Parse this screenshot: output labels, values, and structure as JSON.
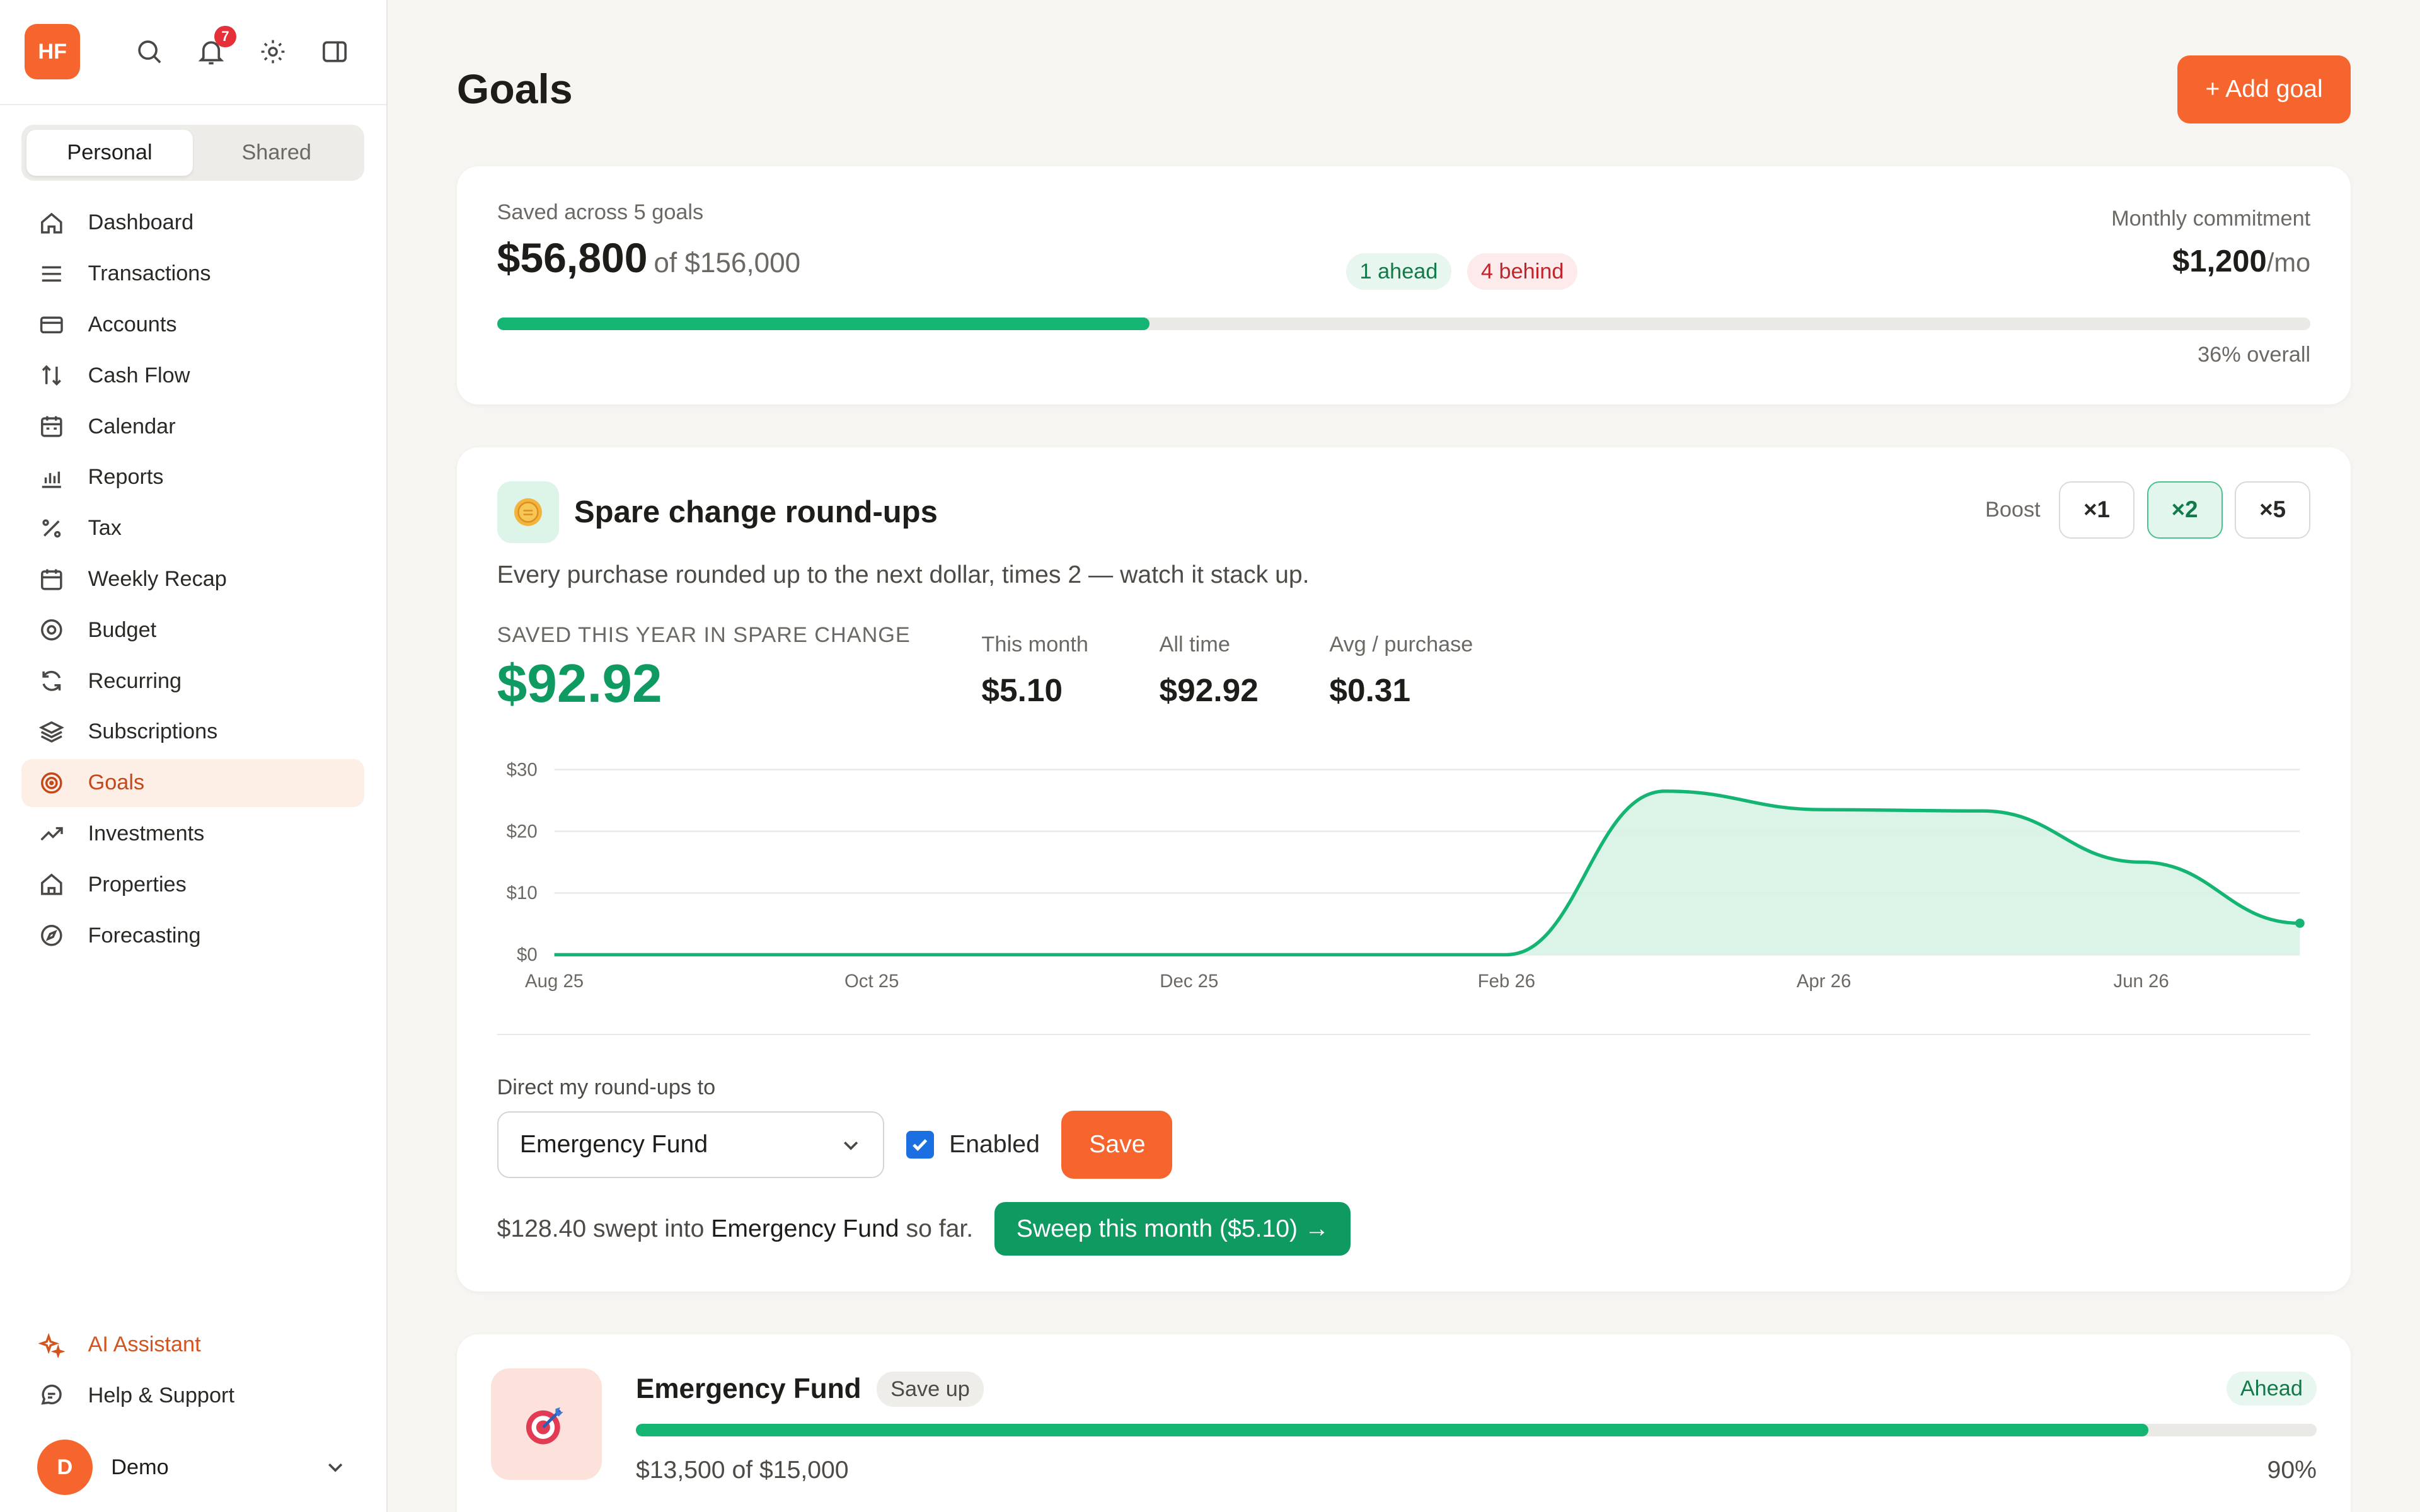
{
  "sidebar": {
    "logo": "HF",
    "notif_count": "7",
    "tabs": [
      {
        "label": "Personal",
        "active": true
      },
      {
        "label": "Shared",
        "active": false
      }
    ],
    "items": [
      {
        "label": "Dashboard",
        "icon": "home-icon"
      },
      {
        "label": "Transactions",
        "icon": "list-icon"
      },
      {
        "label": "Accounts",
        "icon": "card-icon"
      },
      {
        "label": "Cash Flow",
        "icon": "arrows-updown-icon"
      },
      {
        "label": "Calendar",
        "icon": "calendar-icon"
      },
      {
        "label": "Reports",
        "icon": "bar-chart-icon"
      },
      {
        "label": "Tax",
        "icon": "percent-icon"
      },
      {
        "label": "Weekly Recap",
        "icon": "calendar-week-icon"
      },
      {
        "label": "Budget",
        "icon": "target-icon"
      },
      {
        "label": "Recurring",
        "icon": "refresh-icon"
      },
      {
        "label": "Subscriptions",
        "icon": "layers-icon"
      },
      {
        "label": "Goals",
        "icon": "goal-icon",
        "active": true
      },
      {
        "label": "Investments",
        "icon": "trend-up-icon"
      },
      {
        "label": "Properties",
        "icon": "house-icon"
      },
      {
        "label": "Forecasting",
        "icon": "compass-icon"
      }
    ],
    "ai_label": "AI Assistant",
    "help_label": "Help & Support",
    "user": {
      "initial": "D",
      "name": "Demo"
    }
  },
  "page": {
    "title": "Goals",
    "add_label": "+ Add goal"
  },
  "summary": {
    "label": "Saved across 5 goals",
    "saved": "$56,800",
    "of_total": "of $156,000",
    "ahead": "1 ahead",
    "behind": "4 behind",
    "commit_label": "Monthly commitment",
    "commit_amount": "$1,200",
    "commit_unit": "/mo",
    "progress": 0.36,
    "overall": "36% overall"
  },
  "spare": {
    "title": "Spare change round-ups",
    "boost_label": "Boost",
    "boost_options": [
      "×1",
      "×2",
      "×5"
    ],
    "boost_active": 1,
    "description": "Every purchase rounded up to the next dollar, times 2 — watch it stack up.",
    "big_label": "SAVED THIS YEAR IN SPARE CHANGE",
    "big_value": "$92.92",
    "stats": [
      {
        "label": "This month",
        "value": "$5.10"
      },
      {
        "label": "All time",
        "value": "$92.92"
      },
      {
        "label": "Avg / purchase",
        "value": "$0.31"
      }
    ],
    "direct_label": "Direct my round-ups to",
    "target": "Emergency Fund",
    "enabled_label": "Enabled",
    "save_label": "Save",
    "swept_prefix": "$128.40 swept into ",
    "swept_target": "Emergency Fund",
    "swept_suffix": " so far.",
    "sweep_label": "Sweep this month ($5.10) →"
  },
  "chart_data": {
    "type": "area",
    "x": [
      "Aug 25",
      "Sep 25",
      "Oct 25",
      "Nov 25",
      "Dec 25",
      "Jan 26",
      "Feb 26",
      "Mar 26",
      "Apr 26",
      "May 26",
      "Jun 26",
      "Jul 26"
    ],
    "values": [
      0,
      0,
      0,
      0,
      0,
      0,
      0,
      26.5,
      23.5,
      23.3,
      15,
      5.1
    ],
    "tick_labels": [
      "Aug 25",
      "Oct 25",
      "Dec 25",
      "Feb 26",
      "Apr 26",
      "Jun 26"
    ],
    "y_ticks": [
      "$0",
      "$10",
      "$20",
      "$30"
    ],
    "ylim": [
      0,
      30
    ],
    "color": "#14b573",
    "fill": "#d8f3e6"
  },
  "goal": {
    "name": "Emergency Fund",
    "tag": "Save up",
    "status": "Ahead",
    "progress": 0.9,
    "amount": "$13,500 of $15,000",
    "pct": "90%"
  }
}
